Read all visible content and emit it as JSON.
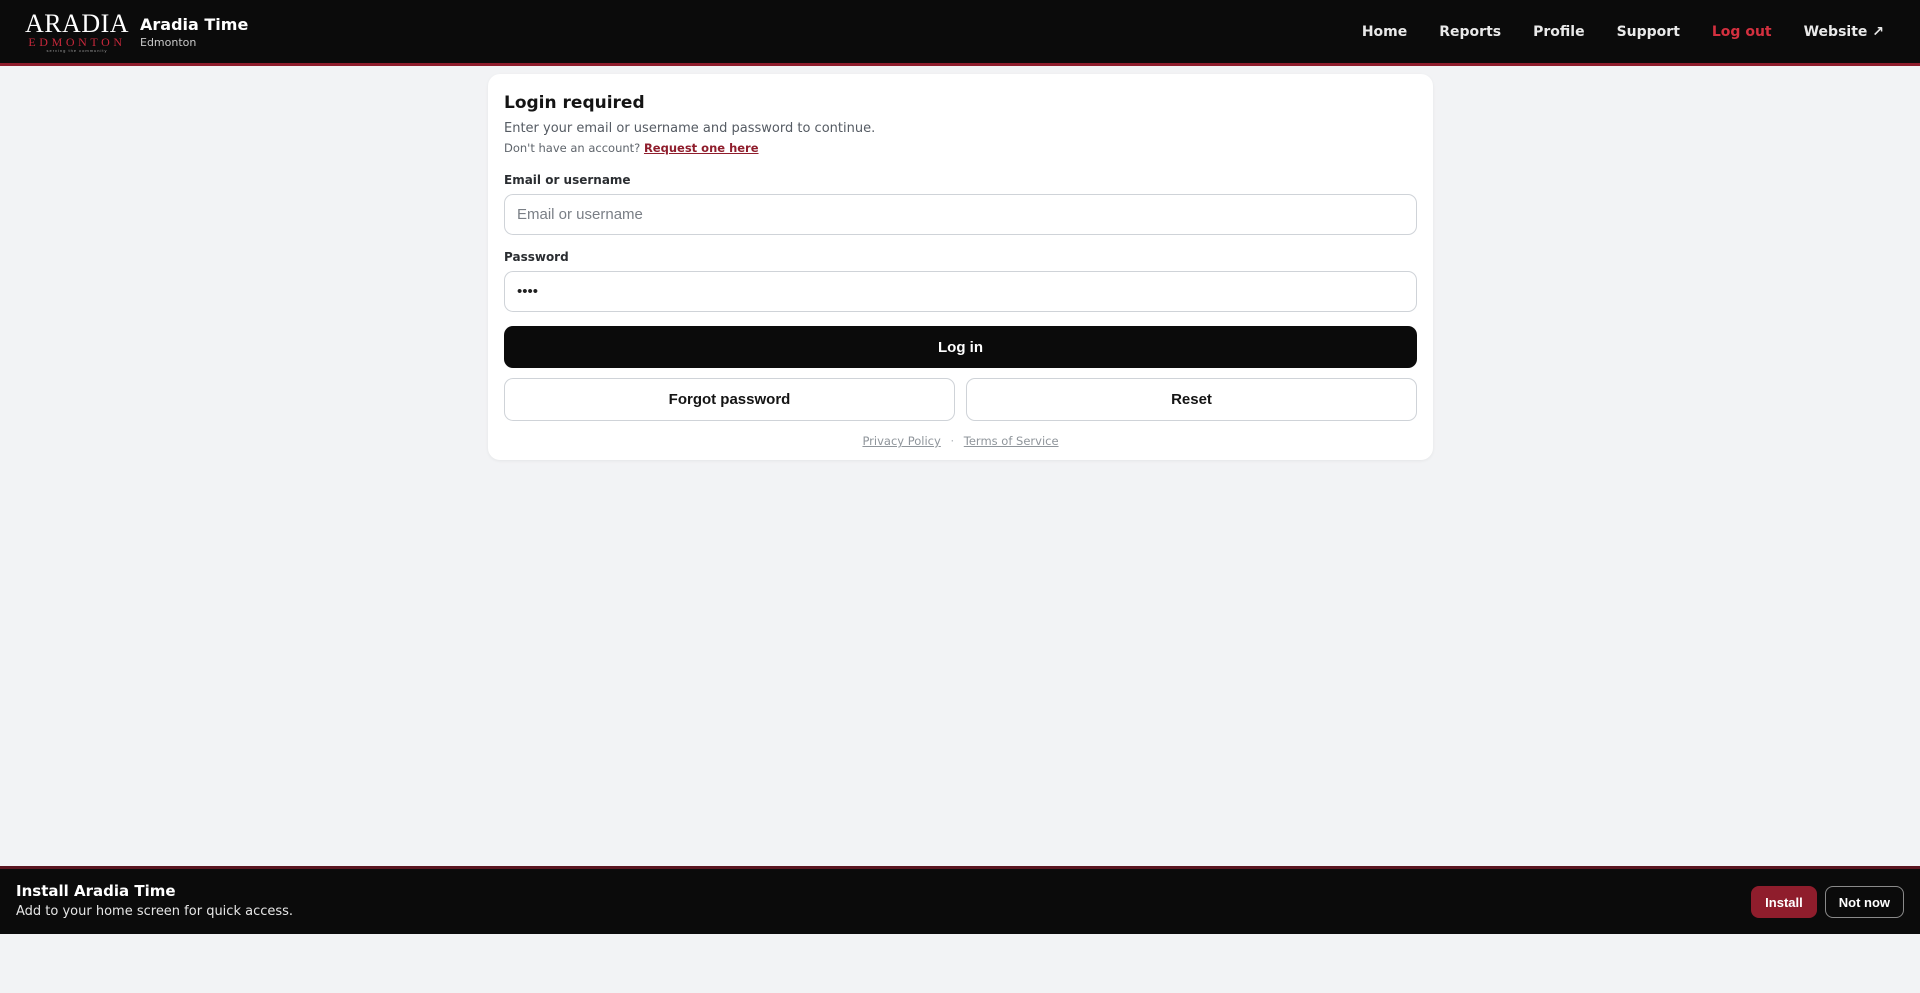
{
  "header": {
    "logo": {
      "main": "ARADIA",
      "sub": "EDMONTON",
      "tagline": "serving the community"
    },
    "app_title": "Aradia Time",
    "app_subtitle": "Edmonton",
    "nav": [
      {
        "label": "Home"
      },
      {
        "label": "Reports"
      },
      {
        "label": "Profile"
      },
      {
        "label": "Support"
      },
      {
        "label": "Log out"
      },
      {
        "label": "Website ↗"
      }
    ]
  },
  "login": {
    "title": "Login required",
    "subtitle": "Enter your email or username and password to continue.",
    "no_account_text": "Don't have an account?",
    "request_link": "Request one here",
    "email_label": "Email or username",
    "email_placeholder": "Email or username",
    "email_value": "",
    "password_label": "Password",
    "password_value": "abcd",
    "login_button": "Log in",
    "forgot_button": "Forgot password",
    "reset_button": "Reset",
    "privacy_link": "Privacy Policy",
    "separator": "·",
    "terms_link": "Terms of Service"
  },
  "install_banner": {
    "title": "Install Aradia Time",
    "subtitle": "Add to your home screen for quick access.",
    "install_button": "Install",
    "not_now_button": "Not now"
  },
  "colors": {
    "brand": "#8f1d2c",
    "logout_link": "#d4303f",
    "header_bg": "#0b0b0b",
    "page_bg": "#f2f3f5"
  }
}
